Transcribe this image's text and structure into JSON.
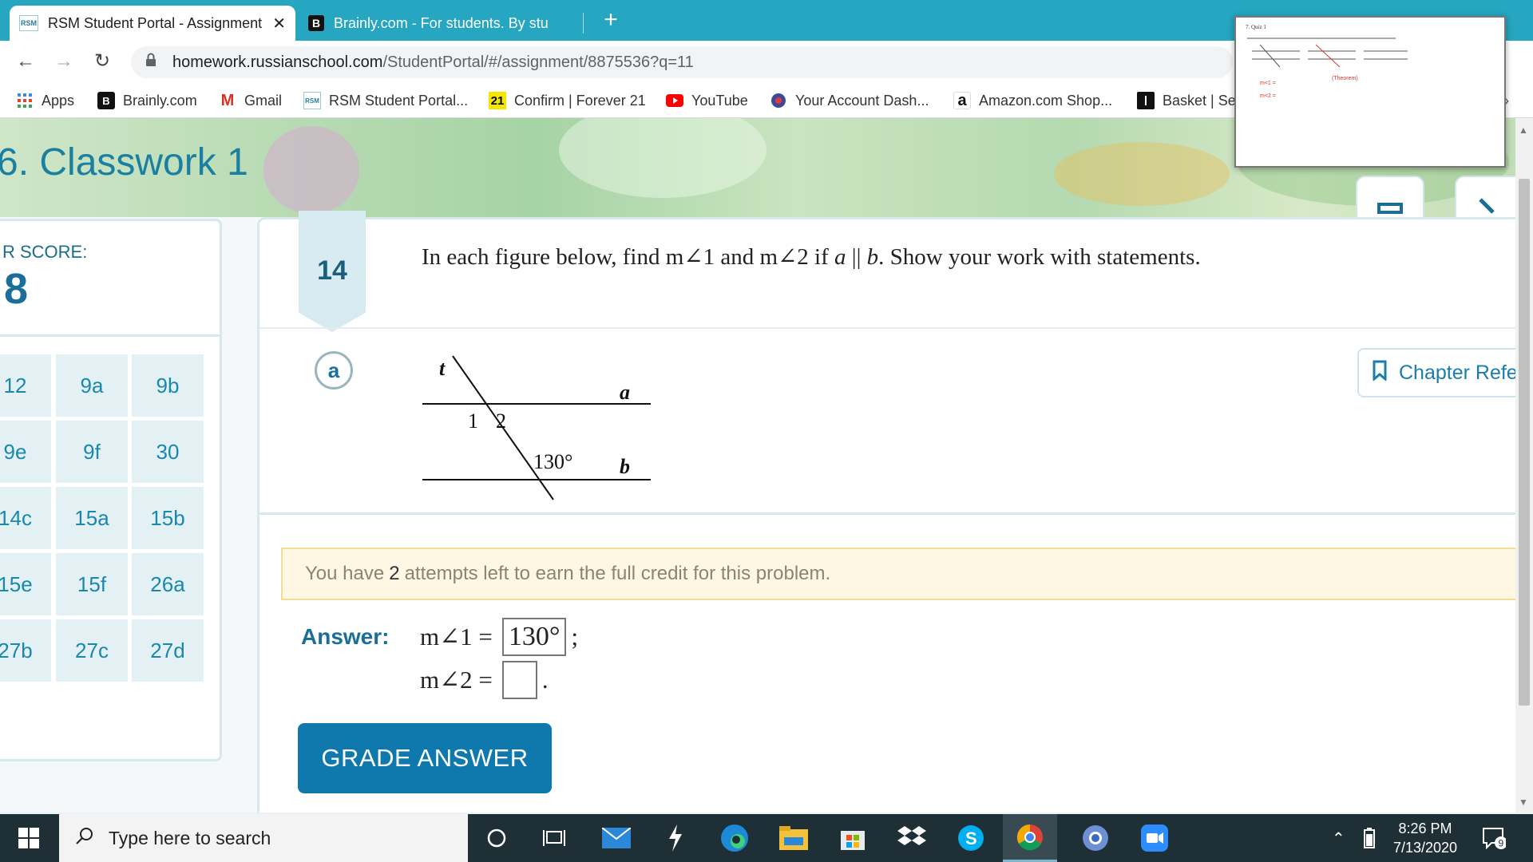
{
  "browser": {
    "tabs": [
      {
        "title": "RSM Student Portal - Assignment",
        "favicon": "RSM",
        "active": true
      },
      {
        "title": "Brainly.com - For students. By stu",
        "favicon": "B",
        "active": false
      }
    ],
    "new_tab": "+",
    "url_host": "homework.russianschool.com",
    "url_path": "/StudentPortal/#/assignment/8875536?q=11",
    "bookmarks": [
      {
        "label": "Apps",
        "icon": "apps-grid-icon"
      },
      {
        "label": "Brainly.com",
        "icon": "B"
      },
      {
        "label": "Gmail",
        "icon": "M"
      },
      {
        "label": "RSM Student Portal...",
        "icon": "RSM"
      },
      {
        "label": "Confirm | Forever 21",
        "icon": "21"
      },
      {
        "label": "YouTube",
        "icon": "youtube-icon"
      },
      {
        "label": "Your Account Dash...",
        "icon": "account-icon"
      },
      {
        "label": "Amazon.com Shop...",
        "icon": "a"
      },
      {
        "label": "Basket | Se",
        "icon": "basket-icon"
      }
    ]
  },
  "page": {
    "title": "6. Classwork 1",
    "score_label": "R SCORE:",
    "score_value": "8",
    "problems": [
      "12",
      "9a",
      "9b",
      "9e",
      "9f",
      "30",
      "14c",
      "15a",
      "15b",
      "15e",
      "15f",
      "26a",
      "27b",
      "27c",
      "27d"
    ]
  },
  "problem": {
    "number": "14",
    "text_before": "In each figure below, find m∠1 and m∠2 if ",
    "var_a": "a",
    "parallel": " || ",
    "var_b": "b",
    "text_after": ". Show your work with statements.",
    "part": "a",
    "figure": {
      "t": "t",
      "a": "a",
      "b": "b",
      "angle1": "1",
      "angle2": "2",
      "given": "130°"
    },
    "chapter_ref": "Chapter Refe",
    "attempts_before": "You have",
    "attempts_count": "2",
    "attempts_after": "attempts left to earn the full credit for this problem.",
    "answer_label": "Answer:",
    "line1_label": "m∠1 =",
    "line1_value": "130°",
    "line1_end": ";",
    "line2_label": "m∠2 =",
    "line2_value": "",
    "line2_end": ".",
    "grade_button": "GRADE ANSWER"
  },
  "preview": {
    "caption": "7. Quiz 1"
  },
  "taskbar": {
    "search_placeholder": "Type here to search",
    "time": "8:26 PM",
    "date": "7/13/2020",
    "notifications": "9"
  },
  "colors": {
    "accent": "#1a7fa8",
    "tab_bar": "#26a6c0",
    "button": "#0f79ae"
  }
}
